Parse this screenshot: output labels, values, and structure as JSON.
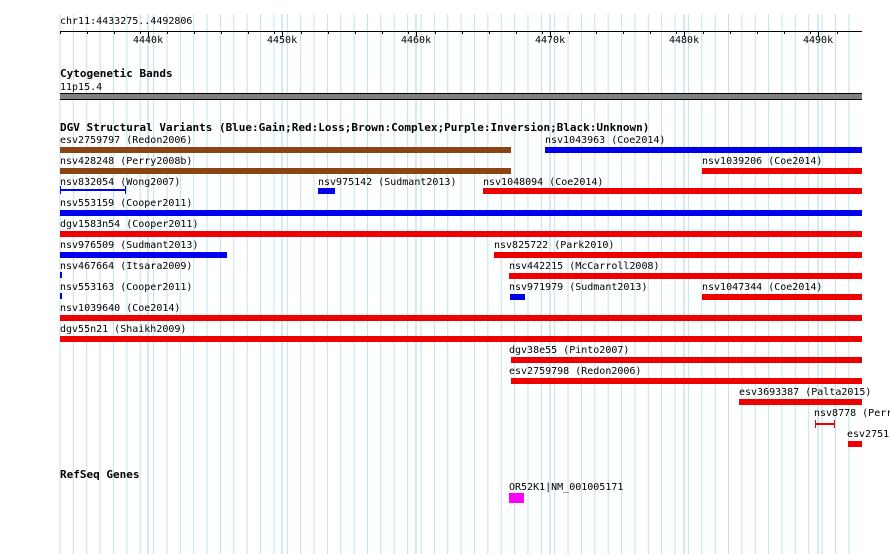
{
  "ruler": {
    "location": "chr11:4433275..4492806",
    "ticks": [
      "4440k",
      "4450k",
      "4460k",
      "4470k",
      "4480k",
      "4490k"
    ]
  },
  "cytoband": {
    "title": "Cytogenetic Bands",
    "band": "11p15.4",
    "band_color": "#808080"
  },
  "dgv": {
    "title": "DGV Structural Variants (Blue:Gain;Red:Loss;Brown:Complex;Purple:Inversion;Black:Unknown)",
    "colors": {
      "gain": "#0000ee",
      "loss": "#ee0000",
      "complex": "#8b4513"
    },
    "features": [
      {
        "name": "esv2759797 (Redon2006)",
        "type": "complex"
      },
      {
        "name": "nsv1043963 (Coe2014)",
        "type": "gain"
      },
      {
        "name": "nsv428248 (Perry2008b)",
        "type": "complex"
      },
      {
        "name": "nsv1039206 (Coe2014)",
        "type": "loss"
      },
      {
        "name": "nsv832054 (Wong2007)",
        "type": "gain"
      },
      {
        "name": "nsv975142 (Sudmant2013)",
        "type": "gain"
      },
      {
        "name": "nsv1048094 (Coe2014)",
        "type": "loss"
      },
      {
        "name": "nsv553159 (Cooper2011)",
        "type": "gain"
      },
      {
        "name": "dgv1583n54 (Cooper2011)",
        "type": "loss"
      },
      {
        "name": "nsv976509 (Sudmant2013)",
        "type": "gain"
      },
      {
        "name": "nsv825722 (Park2010)",
        "type": "loss"
      },
      {
        "name": "nsv467664 (Itsara2009)",
        "type": "gain"
      },
      {
        "name": "nsv442215 (McCarroll2008)",
        "type": "loss"
      },
      {
        "name": "nsv553163 (Cooper2011)",
        "type": "gain"
      },
      {
        "name": "nsv971979 (Sudmant2013)",
        "type": "gain"
      },
      {
        "name": "nsv1047344 (Coe2014)",
        "type": "loss"
      },
      {
        "name": "nsv1039640 (Coe2014)",
        "type": "loss"
      },
      {
        "name": "dgv55n21 (Shaikh2009)",
        "type": "loss"
      },
      {
        "name": "dgv38e55 (Pinto2007)",
        "type": "loss"
      },
      {
        "name": "esv2759798 (Redon2006)",
        "type": "loss"
      },
      {
        "name": "esv3693387 (Palta2015)",
        "type": "loss"
      },
      {
        "name": "nsv8778 (Perr",
        "type": "loss"
      },
      {
        "name": "esv2751",
        "type": "loss"
      }
    ]
  },
  "refseq": {
    "title": "RefSeq Genes",
    "gene": "OR52K1|NM_001005171",
    "gene_color": "#ff00ff"
  }
}
